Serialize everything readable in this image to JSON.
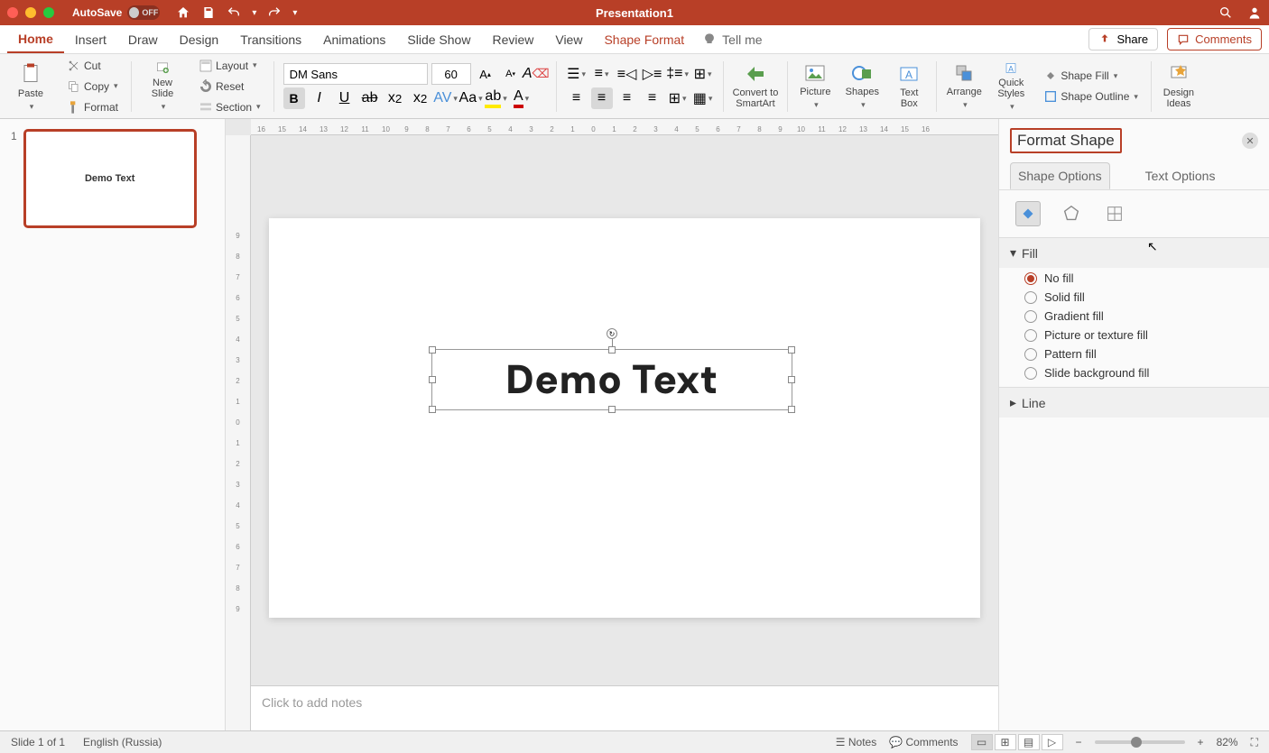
{
  "titlebar": {
    "autosave_label": "AutoSave",
    "autosave_state": "OFF",
    "title": "Presentation1"
  },
  "tabs": {
    "home": "Home",
    "insert": "Insert",
    "draw": "Draw",
    "design": "Design",
    "transitions": "Transitions",
    "animations": "Animations",
    "slideshow": "Slide Show",
    "review": "Review",
    "view": "View",
    "shapeformat": "Shape Format",
    "tellme": "Tell me",
    "share": "Share",
    "comments": "Comments"
  },
  "ribbon": {
    "paste": "Paste",
    "cut": "Cut",
    "copy": "Copy",
    "format": "Format",
    "newslide": "New\nSlide",
    "layout": "Layout",
    "reset": "Reset",
    "section": "Section",
    "font_name": "DM Sans",
    "font_size": "60",
    "convert": "Convert to\nSmartArt",
    "picture": "Picture",
    "shapes": "Shapes",
    "textbox": "Text\nBox",
    "arrange": "Arrange",
    "quickstyles": "Quick\nStyles",
    "shapefill": "Shape Fill",
    "shapeoutline": "Shape Outline",
    "designideas": "Design\nIdeas"
  },
  "slide": {
    "number": "1",
    "thumb_text": "Demo Text",
    "main_text": "Demo Text"
  },
  "notes": {
    "placeholder": "Click to add notes"
  },
  "format_pane": {
    "title": "Format Shape",
    "tab_shape": "Shape Options",
    "tab_text": "Text Options",
    "fill_header": "Fill",
    "line_header": "Line",
    "opts": {
      "nofill": "No fill",
      "solid": "Solid fill",
      "gradient": "Gradient fill",
      "picture": "Picture or texture fill",
      "pattern": "Pattern fill",
      "slidebg": "Slide background fill"
    }
  },
  "statusbar": {
    "slide": "Slide 1 of 1",
    "lang": "English (Russia)",
    "notes": "Notes",
    "comments": "Comments",
    "zoom": "82%"
  },
  "ruler_h": [
    "16",
    "15",
    "14",
    "13",
    "12",
    "11",
    "10",
    "9",
    "8",
    "7",
    "6",
    "5",
    "4",
    "3",
    "2",
    "1",
    "0",
    "1",
    "2",
    "3",
    "4",
    "5",
    "6",
    "7",
    "8",
    "9",
    "10",
    "11",
    "12",
    "13",
    "14",
    "15",
    "16"
  ],
  "ruler_v": [
    "9",
    "8",
    "7",
    "6",
    "5",
    "4",
    "3",
    "2",
    "1",
    "0",
    "1",
    "2",
    "3",
    "4",
    "5",
    "6",
    "7",
    "8",
    "9"
  ]
}
